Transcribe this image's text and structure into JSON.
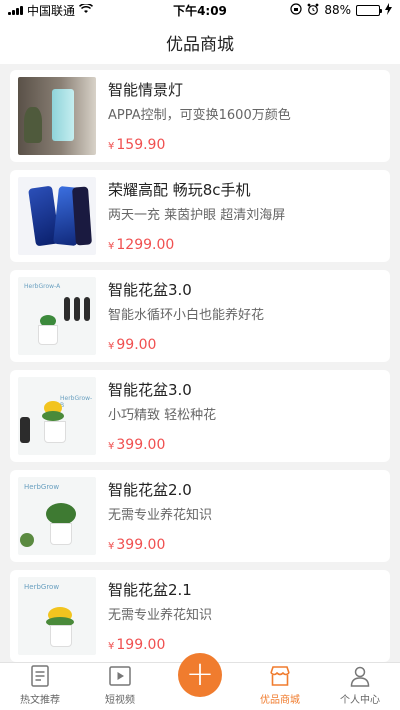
{
  "status_bar": {
    "carrier": "中国联通",
    "time": "下午4:09",
    "battery": "88%",
    "battery_level": 0.88
  },
  "header": {
    "title": "优品商城"
  },
  "products": [
    {
      "title": "智能情景灯",
      "desc": "APPA控制，可变换1600万颜色",
      "currency": "¥",
      "price": "159.90",
      "thumb": "lamp"
    },
    {
      "title": "荣耀高配 畅玩8c手机",
      "desc": "两天一充 莱茵护眼 超清刘海屏",
      "currency": "¥",
      "price": "1299.00",
      "thumb": "phone"
    },
    {
      "title": "智能花盆3.0",
      "desc": "智能水循环小白也能养好花",
      "currency": "¥",
      "price": "99.00",
      "thumb": "pot-a"
    },
    {
      "title": "智能花盆3.0",
      "desc": "小巧精致 轻松种花",
      "currency": "¥",
      "price": "399.00",
      "thumb": "pot-b"
    },
    {
      "title": "智能花盆2.0",
      "desc": "无需专业养花知识",
      "currency": "¥",
      "price": "399.00",
      "thumb": "pot-c"
    },
    {
      "title": "智能花盆2.1",
      "desc": "无需专业养花知识",
      "currency": "¥",
      "price": "199.00",
      "thumb": "pot-d"
    }
  ],
  "thumb_text": {
    "herbgrow_a": "HerbGrow-A",
    "herbgrow_b": "HerbGrow-B",
    "herbgrow": "HerbGrow"
  },
  "tabbar": {
    "tabs": [
      {
        "label": "热文推荐",
        "icon": "document-icon"
      },
      {
        "label": "短视频",
        "icon": "video-icon"
      },
      {
        "label": "",
        "icon": "plus-icon"
      },
      {
        "label": "优品商城",
        "icon": "shop-icon",
        "active": true
      },
      {
        "label": "个人中心",
        "icon": "person-icon"
      }
    ],
    "fab_symbol": "+"
  },
  "colors": {
    "accent": "#f07c2e",
    "price": "#f05050",
    "background": "#f2f2f2"
  }
}
